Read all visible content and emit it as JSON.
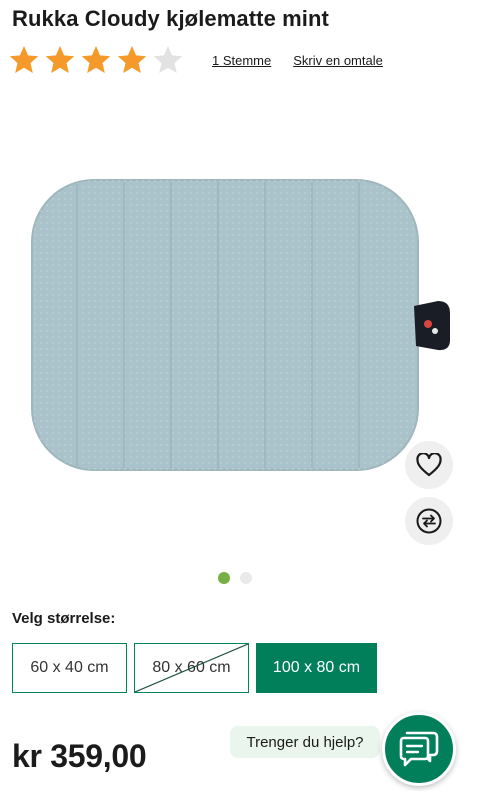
{
  "product": {
    "title": "Rukka Cloudy kjølematte mint",
    "rating": {
      "value": 4,
      "max": 5
    },
    "votes_label": "1 Stemme",
    "review_link": "Skriv en omtale",
    "image": {
      "alt": "Rukka Cloudy kjølematte mint"
    }
  },
  "gallery": {
    "slides": 2,
    "active": 1
  },
  "actions": {
    "favorite_icon": "heart-icon",
    "compare_icon": "compare-arrows-icon"
  },
  "size": {
    "label": "Velg størrelse:",
    "options": [
      {
        "label": "60 x 40 cm",
        "state": "available"
      },
      {
        "label": "80 x 60 cm",
        "state": "unavailable"
      },
      {
        "label": "100 x 80 cm",
        "state": "selected"
      }
    ]
  },
  "price": "kr 359,00",
  "help": {
    "bubble": "Trenger du hjelp?",
    "icon": "chat-icon"
  },
  "colors": {
    "accent": "#007f5a",
    "star": "#f59a2a",
    "star_empty": "#e2e2e2",
    "dot_active": "#76b043",
    "mat": "#aac3cb"
  }
}
